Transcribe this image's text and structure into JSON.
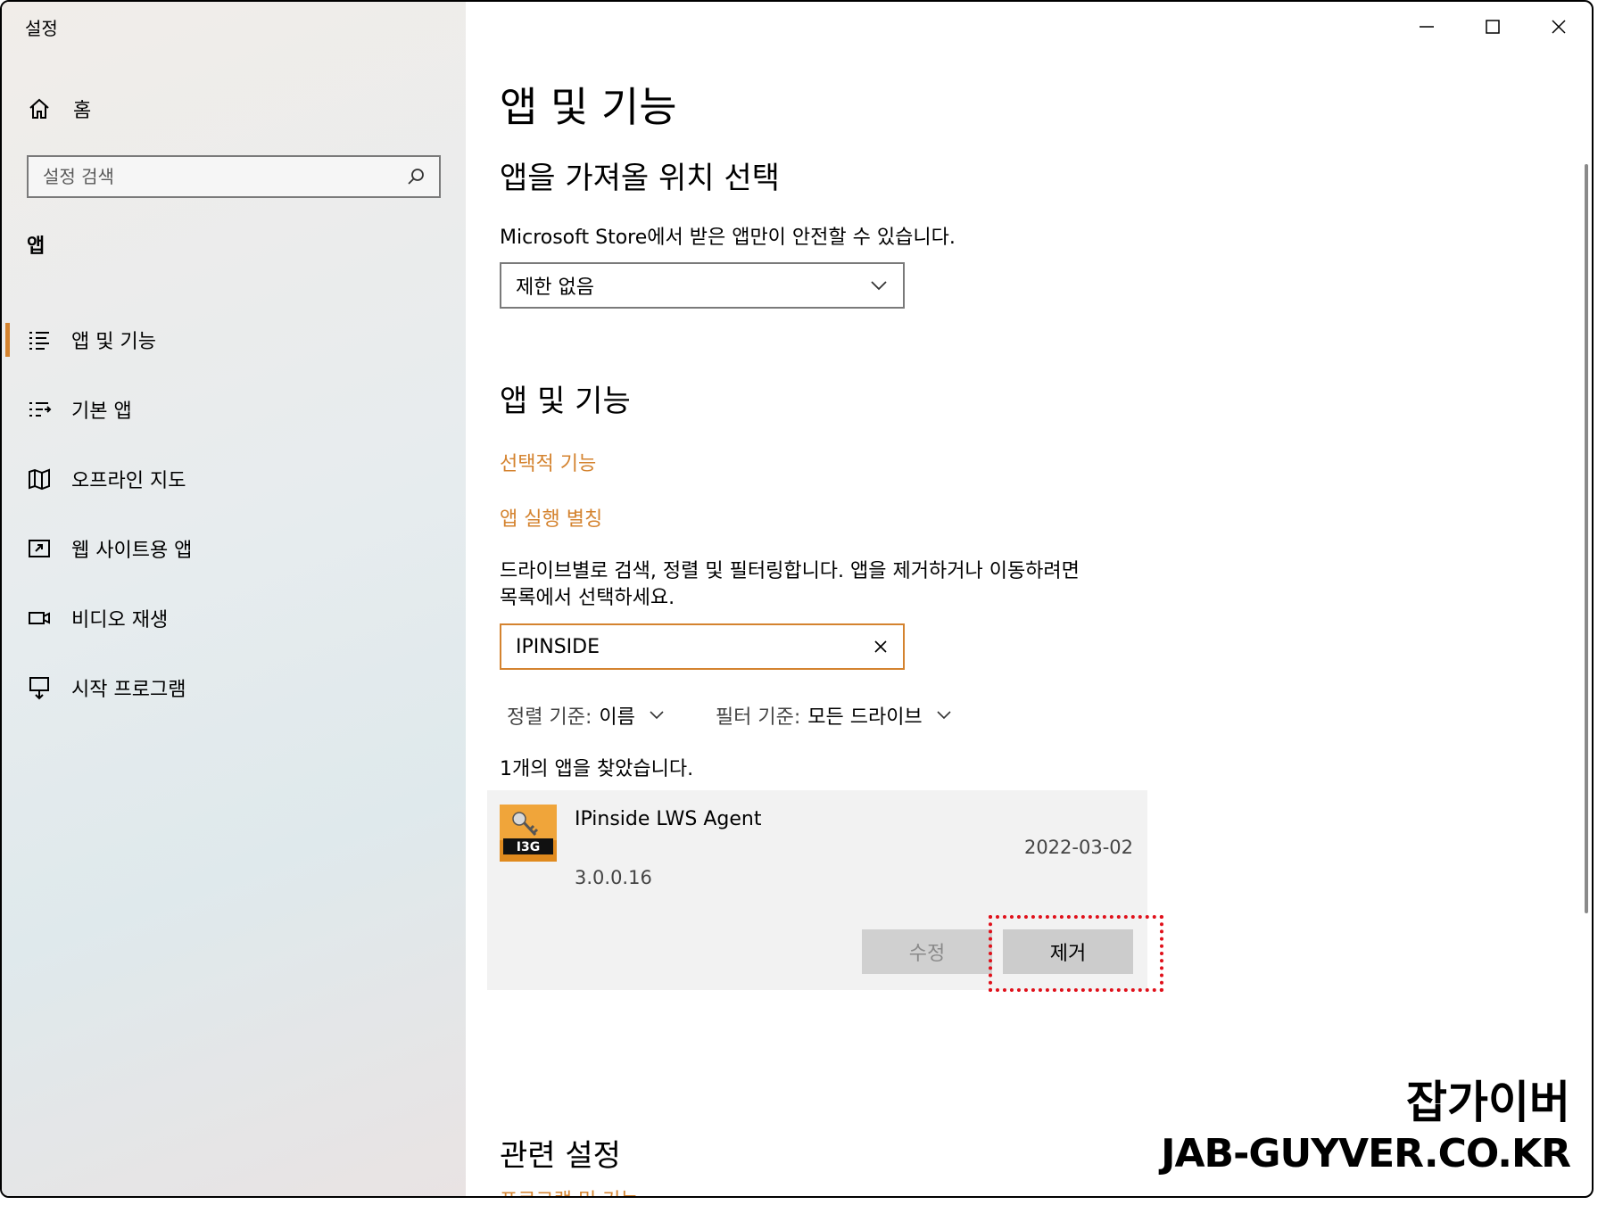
{
  "window": {
    "title": "설정"
  },
  "sidebar": {
    "home_label": "홈",
    "search_placeholder": "설정 검색",
    "section": "앱",
    "items": [
      {
        "label": "앱 및 기능",
        "icon": "list-icon",
        "active": true
      },
      {
        "label": "기본 앱",
        "icon": "default-apps-icon",
        "active": false
      },
      {
        "label": "오프라인 지도",
        "icon": "map-icon",
        "active": false
      },
      {
        "label": "웹 사이트용 앱",
        "icon": "website-app-icon",
        "active": false
      },
      {
        "label": "비디오 재생",
        "icon": "video-icon",
        "active": false
      },
      {
        "label": "시작 프로그램",
        "icon": "startup-icon",
        "active": false
      }
    ]
  },
  "main": {
    "title": "앱 및 기능",
    "source_heading": "앱을 가져올 위치 선택",
    "source_desc": "Microsoft Store에서 받은 앱만이 안전할 수 있습니다.",
    "source_value": "제한 없음",
    "apps_heading": "앱 및 기능",
    "link_optional": "선택적 기능",
    "link_alias": "앱 실행 별칭",
    "filter_desc_line1": "드라이브별로 검색, 정렬 및 필터링합니다. 앱을 제거하거나 이동하려면",
    "filter_desc_line2": "목록에서 선택하세요.",
    "filter_value": "IPINSIDE",
    "sort_key": "정렬 기준:",
    "sort_value": "이름",
    "filter_key": "필터 기준:",
    "filter_by_value": "모든 드라이브",
    "found_text": "1개의 앱을 찾았습니다.",
    "app": {
      "name": "IPinside LWS Agent",
      "date": "2022-03-02",
      "version": "3.0.0.16",
      "icon_text": "I3G",
      "modify_label": "수정",
      "uninstall_label": "제거"
    },
    "related_heading": "관련 설정",
    "related_link": "프로그램 및 기능"
  },
  "watermark": {
    "line1": "잡가이버",
    "line2": "JAB-GUYVER.CO.KR"
  },
  "colors": {
    "accent": "#d4832f",
    "highlight": "#e0101a"
  }
}
